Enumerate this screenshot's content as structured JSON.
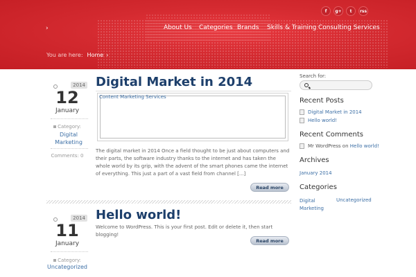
{
  "header": {
    "nav": [
      {
        "label": "About Us"
      },
      {
        "label": "Categories"
      },
      {
        "label": "Brands"
      },
      {
        "label": "Skills & Training"
      },
      {
        "label": "Consulting Services"
      }
    ],
    "social": [
      {
        "glyph": "f",
        "icon": "facebook-icon"
      },
      {
        "glyph": "g+",
        "icon": "google-plus-icon"
      },
      {
        "glyph": "t",
        "icon": "twitter-icon"
      },
      {
        "glyph": "rss",
        "icon": "rss-icon"
      }
    ],
    "breadcrumb": {
      "prefix": "You are here:",
      "home": "Home",
      "sep": "›"
    },
    "accent": "#d42a30"
  },
  "posts": [
    {
      "title": "Digital Market in 2014",
      "year": "2014",
      "day": "12",
      "month": "January",
      "category_label": "Category:",
      "category": "Digital Marketing",
      "comments": "Comments: 0",
      "embed_title": "Content Marketing Services",
      "excerpt": "The digital market in 2014 Once a field thought to be just about computers and their parts, the software industry thanks to the internet and has taken the whole world by its grip, with the advent of the smart phones came the internet of everything. This just a part of a vast field from channel [...]",
      "read_more": "Read more"
    },
    {
      "title": "Hello world!",
      "year": "2014",
      "day": "11",
      "month": "January",
      "category_label": "Category:",
      "category": "Uncategorized",
      "excerpt": "Welcome to WordPress. This is your first post. Edit or delete it, then start blogging!",
      "read_more": "Read more"
    }
  ],
  "sidebar": {
    "search_label": "Search for:",
    "recent_posts_heading": "Recent Posts",
    "recent_posts": [
      "Digital Market in 2014",
      "Hello world!"
    ],
    "recent_comments_heading": "Recent Comments",
    "recent_comment": {
      "author": "Mr WordPress",
      "on": "on",
      "post": "Hello world!"
    },
    "archives_heading": "Archives",
    "archives": [
      "January 2014"
    ],
    "categories_heading": "Categories",
    "categories": [
      "Digital Marketing",
      "Uncategorized"
    ]
  }
}
